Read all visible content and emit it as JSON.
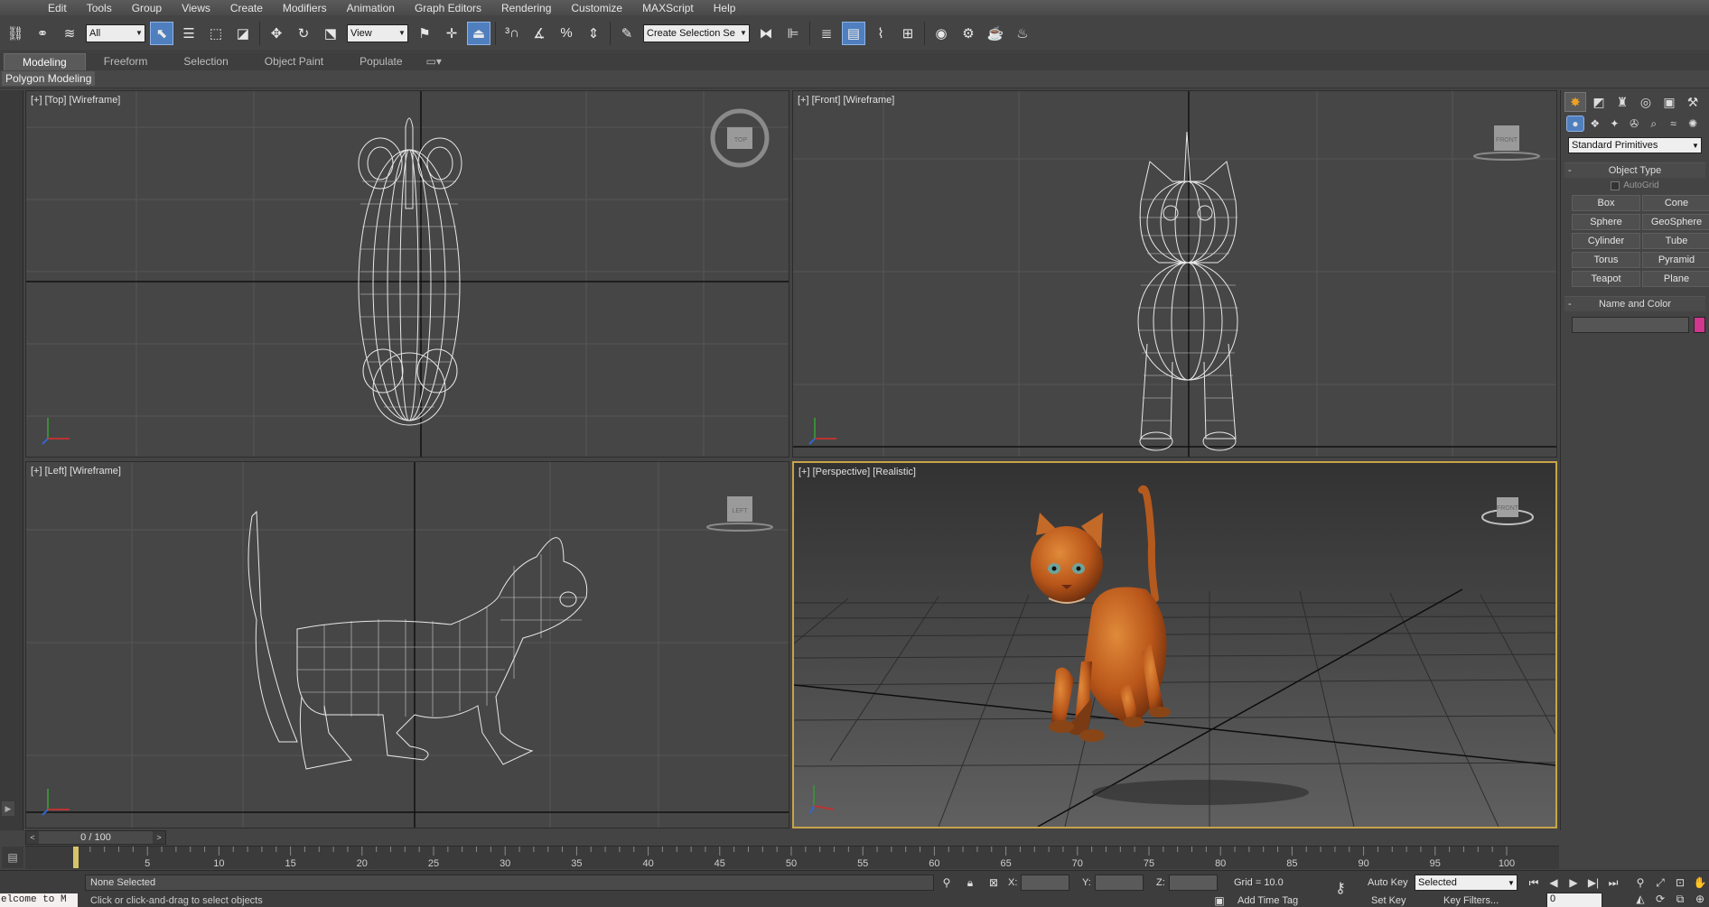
{
  "menu": [
    "Edit",
    "Tools",
    "Group",
    "Views",
    "Create",
    "Modifiers",
    "Animation",
    "Graph Editors",
    "Rendering",
    "Customize",
    "MAXScript",
    "Help"
  ],
  "toolbar": {
    "selection_filter": "All",
    "ref_coord": "View",
    "named_selection": "Create Selection Se"
  },
  "ribbon": {
    "tabs": [
      "Modeling",
      "Freeform",
      "Selection",
      "Object Paint",
      "Populate"
    ],
    "active_tab": "Modeling",
    "panel_label": "Polygon Modeling"
  },
  "viewports": {
    "top": {
      "plus": "[+]",
      "name": "[Top]",
      "mode": "[Wireframe]",
      "cube": "TOP"
    },
    "front": {
      "plus": "[+]",
      "name": "[Front]",
      "mode": "[Wireframe]",
      "cube": "FRONT"
    },
    "left": {
      "plus": "[+]",
      "name": "[Left]",
      "mode": "[Wireframe]",
      "cube": "LEFT"
    },
    "perspective": {
      "plus": "[+]",
      "name": "[Perspective]",
      "mode": "[Realistic]",
      "cube": "FRONT"
    }
  },
  "command_panel": {
    "primitive_type": "Standard Primitives",
    "object_type_title": "Object Type",
    "autogrid_label": "AutoGrid",
    "buttons": [
      "Box",
      "Cone",
      "Sphere",
      "GeoSphere",
      "Cylinder",
      "Tube",
      "Torus",
      "Pyramid",
      "Teapot",
      "Plane"
    ],
    "name_color_title": "Name and Color",
    "object_color": "#d0378d"
  },
  "timeline": {
    "frame_display": "0 / 100",
    "ticks": [
      5,
      10,
      15,
      20,
      25,
      30,
      35,
      40,
      45,
      50,
      55,
      60,
      65,
      70,
      75,
      80,
      85,
      90,
      95,
      100
    ]
  },
  "status": {
    "selection": "None Selected",
    "prompt": "Click or click-and-drag to select objects",
    "x_label": "X:",
    "y_label": "Y:",
    "z_label": "Z:",
    "grid": "Grid = 10.0",
    "add_time_tag": "Add Time Tag",
    "auto_key": "Auto Key",
    "set_key": "Set Key",
    "key_mode": "Selected",
    "key_filters": "Key Filters...",
    "frame_value": "0",
    "listener": "elcome to M"
  },
  "colors": {
    "active_viewport_border": "#c7a44a",
    "active_button": "#4f7fbf",
    "cat_orange": "#c7621f"
  }
}
